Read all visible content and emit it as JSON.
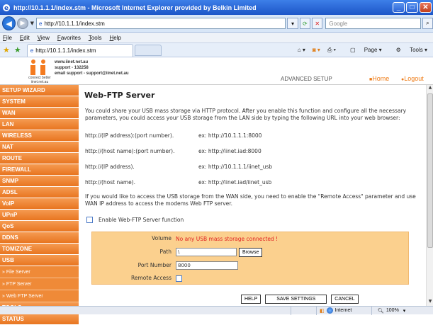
{
  "window": {
    "title": "http://10.1.1.1/index.stm - Microsoft Internet Explorer provided by Belkin Limited"
  },
  "address": {
    "url": "http://10.1.1.1/index.stm",
    "search_placeholder": "Google"
  },
  "menu": [
    "File",
    "Edit",
    "View",
    "Favorites",
    "Tools",
    "Help"
  ],
  "tab": {
    "label": "http://10.1.1.1/index.stm"
  },
  "commands": {
    "page": "Page",
    "tools": "Tools"
  },
  "header": {
    "site": "www.iinet.net.au",
    "support": "support - 132258",
    "email": "email support - support@iinet.net.au",
    "logo_caption1": "connect better",
    "logo_caption2": "iinet.net.au",
    "advanced": "ADVANCED SETUP",
    "home": "Home",
    "logout": "Logout"
  },
  "sidebar": {
    "items": [
      "SETUP WIZARD",
      "SYSTEM",
      "WAN",
      "LAN",
      "WIRELESS",
      "NAT",
      "ROUTE",
      "FIREWALL",
      "SNMP",
      "ADSL",
      "VoIP",
      "UPnP",
      "QoS",
      "DDNS",
      "TOMIZONE",
      "USB"
    ],
    "sub": [
      "» File Server",
      "» FTP Server",
      "» Web FTP Server"
    ],
    "bottom": [
      "TOOLS",
      "STATUS"
    ]
  },
  "main": {
    "title": "Web-FTP Server",
    "intro": "You could share your USB mass storage via HTTP protocol. After you enable this function and configure all the necessary parameters, you could access your USB storage from the LAN side by typing the following URL into your web browser:",
    "urls": [
      {
        "pattern": "http://(IP address):(port number).",
        "example": "ex: http://10.1.1.1:8000"
      },
      {
        "pattern": "http://(host name):(port number).",
        "example": "ex: http://iinet.iad:8000"
      },
      {
        "pattern": "http://(IP address).",
        "example": "ex: http://10.1.1.1/iinet_usb"
      },
      {
        "pattern": "http://(host name).",
        "example": "ex: http://iinet.iad/iinet_usb"
      }
    ],
    "wan_note": "If you would like to access the USB storage from the WAN side, you need to enable the \"Remote Access\" parameter and use WAN IP address to access the modems Web FTP server.",
    "enable_label": "Enable Web-FTP Server function",
    "form": {
      "volume_label": "Volume",
      "volume_value": "No any USB mass storage connected !",
      "path_label": "Path",
      "path_value": "\\",
      "browse": "Browse",
      "port_label": "Port Number",
      "port_value": "8000",
      "remote_label": "Remote Access"
    },
    "buttons": {
      "help": "HELP",
      "save": "SAVE SETTINGS",
      "cancel": "CANCEL"
    }
  },
  "status": {
    "zone": "Internet",
    "zoom": "100%"
  },
  "colors": {
    "accent": "#ee7d1a",
    "warning": "#e02020",
    "form_bg": "#fbd08e"
  }
}
